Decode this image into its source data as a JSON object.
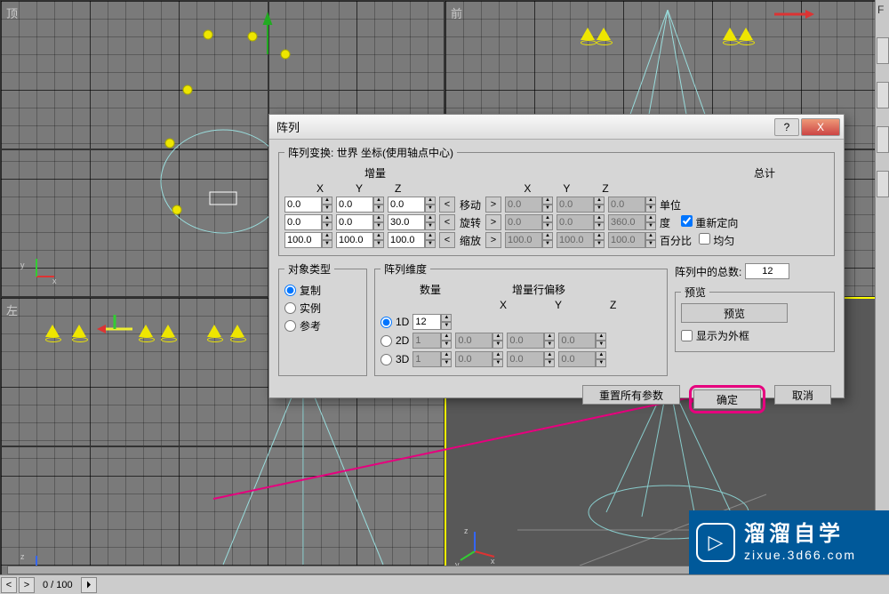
{
  "viewports": {
    "top_left": "顶",
    "top_right": "前",
    "bottom_left": "左",
    "bottom_right": ""
  },
  "dialog": {
    "title": "阵列",
    "groups": {
      "transform": "阵列变换: 世界 坐标(使用轴点中心)",
      "increment": "增量",
      "total": "总计",
      "obj_type": "对象类型",
      "dims": "阵列维度",
      "count_in_array": "阵列中的总数:",
      "preview": "预览"
    },
    "axis": {
      "x": "X",
      "y": "Y",
      "z": "Z"
    },
    "ops": {
      "move": "移动",
      "rotate": "旋转",
      "scale": "缩放"
    },
    "units": {
      "unit": "单位",
      "deg": "度",
      "pct": "百分比"
    },
    "checks": {
      "reorient": "重新定向",
      "uniform": "均匀",
      "wire": "显示为外框"
    },
    "increment_values": {
      "move": {
        "x": "0.0",
        "y": "0.0",
        "z": "0.0"
      },
      "rotate": {
        "x": "0.0",
        "y": "0.0",
        "z": "30.0"
      },
      "scale": {
        "x": "100.0",
        "y": "100.0",
        "z": "100.0"
      }
    },
    "total_values": {
      "move": {
        "x": "0.0",
        "y": "0.0",
        "z": "0.0"
      },
      "rotate": {
        "x": "0.0",
        "y": "0.0",
        "z": "360.0"
      },
      "scale": {
        "x": "100.0",
        "y": "100.0",
        "z": "100.0"
      }
    },
    "obj_type": {
      "copy": "复制",
      "instance": "实例",
      "reference": "参考"
    },
    "dims_labels": {
      "count": "数量",
      "inc_row": "增量行偏移",
      "d1": "1D",
      "d2": "2D",
      "d3": "3D"
    },
    "dims_values": {
      "d1": {
        "count": "12"
      },
      "d2": {
        "count": "1",
        "x": "0.0",
        "y": "0.0",
        "z": "0.0"
      },
      "d3": {
        "count": "1",
        "x": "0.0",
        "y": "0.0",
        "z": "0.0"
      }
    },
    "total_count": "12",
    "buttons": {
      "preview": "预览",
      "reset": "重置所有参数",
      "ok": "确定",
      "cancel": "取消"
    }
  },
  "statusbar": {
    "frame": "0 / 100"
  },
  "watermark": {
    "main": "溜溜自学",
    "sub": "zixue.3d66.com"
  },
  "side_panel_letter": "F"
}
